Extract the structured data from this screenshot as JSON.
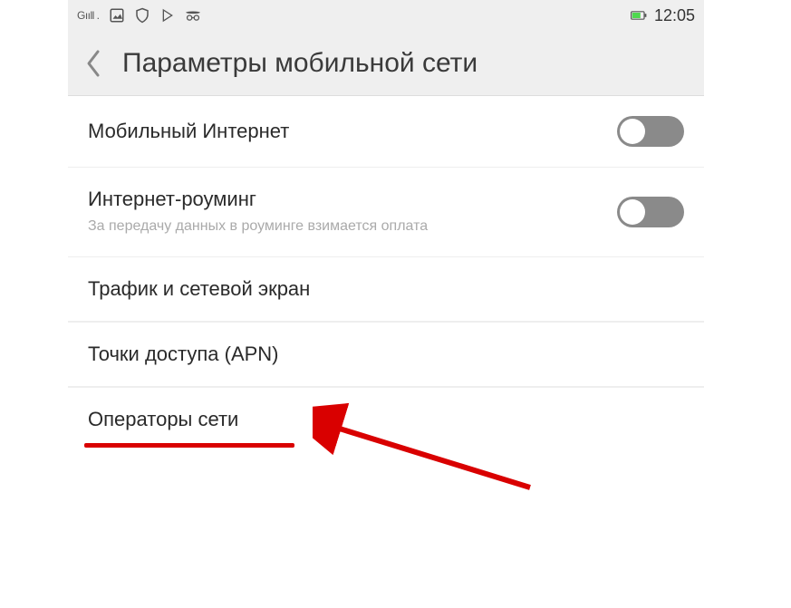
{
  "status": {
    "signal_text": "Gııll .",
    "time": "12:05"
  },
  "icons": {
    "signal": "signal-icon",
    "picture": "picture-icon",
    "shield": "shield-icon",
    "play": "play-icon",
    "incognito": "incognito-icon",
    "battery": "battery-icon"
  },
  "header": {
    "title": "Параметры мобильной сети"
  },
  "rows": {
    "mobile_internet": {
      "label": "Мобильный Интернет",
      "on": false
    },
    "roaming": {
      "label": "Интернет-роуминг",
      "sub": "За передачу данных в роуминге взимается оплата",
      "on": false
    },
    "traffic": {
      "label": "Трафик и сетевой экран"
    },
    "apn": {
      "label": "Точки доступа (APN)"
    },
    "operators": {
      "label": "Операторы сети"
    }
  }
}
